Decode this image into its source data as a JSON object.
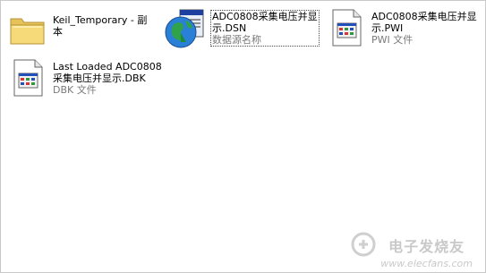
{
  "files": [
    {
      "name_line1": "Keil_Temporary - 副",
      "name_line2": "本",
      "icon": "folder-icon"
    },
    {
      "name_line1": "ADC0808采集电压并显",
      "name_line2": "示.DSN",
      "type": "数据源名称",
      "icon": "odbc-dsn-icon"
    },
    {
      "name_line1": "ADC0808采集电压并显",
      "name_line2": "示.PWI",
      "type": "PWI 文件",
      "icon": "document-icon"
    },
    {
      "name_line1": "Last Loaded ADC0808",
      "name_line2": "采集电压并显示.DBK",
      "type": "DBK 文件",
      "icon": "document-icon"
    }
  ],
  "watermark": {
    "title": "电子发烧友",
    "url": "www.elecfans.com",
    "icon": "elecfans-logo-icon"
  }
}
